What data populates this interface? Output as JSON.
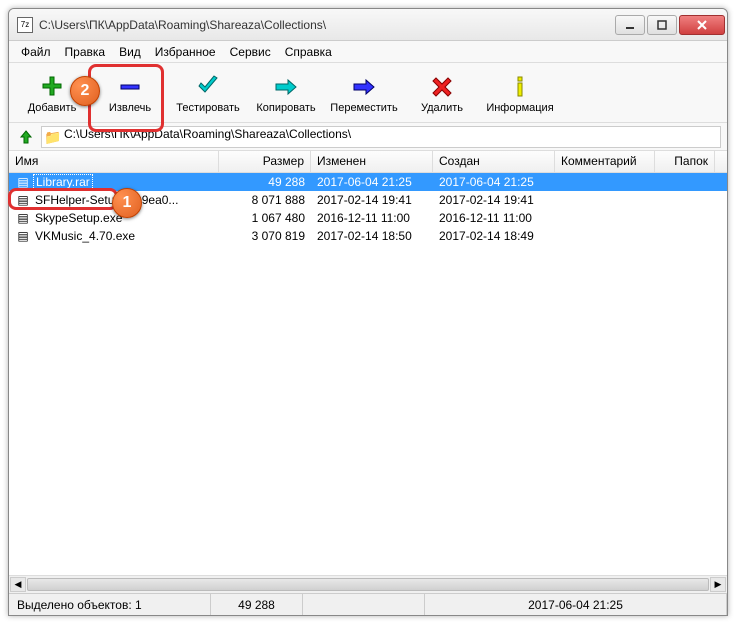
{
  "title": "C:\\Users\\ПК\\AppData\\Roaming\\Shareaza\\Collections\\",
  "menu": {
    "file": "Файл",
    "edit": "Правка",
    "view": "Вид",
    "fav": "Избранное",
    "tools": "Сервис",
    "help": "Справка"
  },
  "toolbar": {
    "add": "Добавить",
    "extract": "Извлечь",
    "test": "Тестировать",
    "copy": "Копировать",
    "move": "Переместить",
    "delete": "Удалить",
    "info": "Информация"
  },
  "path": "C:\\Users\\ПК\\AppData\\Roaming\\Shareaza\\Collections\\",
  "columns": {
    "name": "Имя",
    "size": "Размер",
    "modified": "Изменен",
    "created": "Создан",
    "comment": "Комментарий",
    "folders": "Папок"
  },
  "rows": [
    {
      "name": "Library.rar",
      "size": "49 288",
      "modified": "2017-06-04 21:25",
      "created": "2017-06-04 21:25",
      "selected": true
    },
    {
      "name": "SFHelper-Setup-[199ea0...",
      "size": "8 071 888",
      "modified": "2017-02-14 19:41",
      "created": "2017-02-14 19:41",
      "selected": false
    },
    {
      "name": "SkypeSetup.exe",
      "size": "1 067 480",
      "modified": "2016-12-11 11:00",
      "created": "2016-12-11 11:00",
      "selected": false
    },
    {
      "name": "VKMusic_4.70.exe",
      "size": "3 070 819",
      "modified": "2017-02-14 18:50",
      "created": "2017-02-14 18:49",
      "selected": false
    }
  ],
  "status": {
    "label": "Выделено объектов: 1",
    "size": "49 288",
    "modified": "2017-06-04 21:25"
  },
  "badges": {
    "b1": "1",
    "b2": "2"
  },
  "app_icon": "7z"
}
